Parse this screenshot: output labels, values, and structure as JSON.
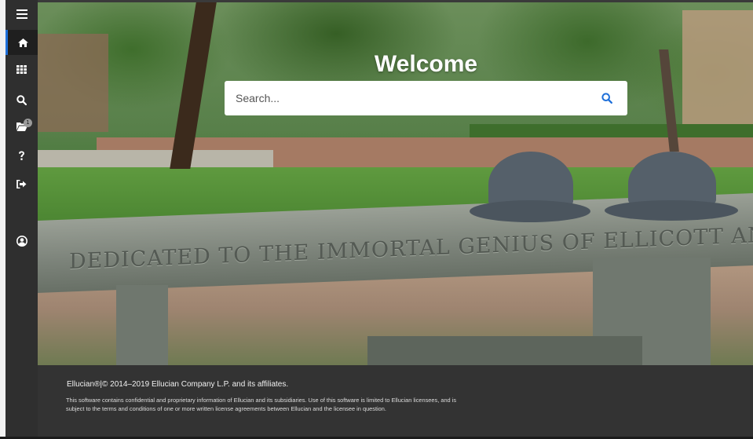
{
  "sidebar": {
    "items": [
      {
        "name": "menu",
        "icon": "hamburger-menu-icon"
      },
      {
        "name": "home",
        "icon": "home-icon",
        "active": true
      },
      {
        "name": "applications",
        "icon": "grid-icon"
      },
      {
        "name": "search",
        "icon": "search-icon"
      },
      {
        "name": "recently-opened",
        "icon": "folder-open-icon",
        "badge": "1"
      },
      {
        "name": "help",
        "icon": "question-icon"
      },
      {
        "name": "sign-out",
        "icon": "sign-out-icon"
      },
      {
        "name": "user-profile",
        "icon": "user-circle-icon"
      }
    ],
    "accent_color": "#1e6fd9"
  },
  "main": {
    "heading": "Welcome",
    "search": {
      "placeholder": "Search...",
      "value": "",
      "icon": "search-icon",
      "icon_color": "#1e6fd9"
    },
    "hero_inscription": "DEDICATED TO THE IMMORTAL GENIUS OF ELLICOTT AND GENTILE AND WILLIAM"
  },
  "footer": {
    "copyright": "Ellucian®|© 2014–2019 Ellucian Company L.P. and its affiliates.",
    "notice": "This software contains confidential and proprietary information of Ellucian and its subsidiaries. Use of this software is limited to Ellucian licensees, and is subject to the terms and conditions of one or more written license agreements between Ellucian and the licensee in question."
  }
}
